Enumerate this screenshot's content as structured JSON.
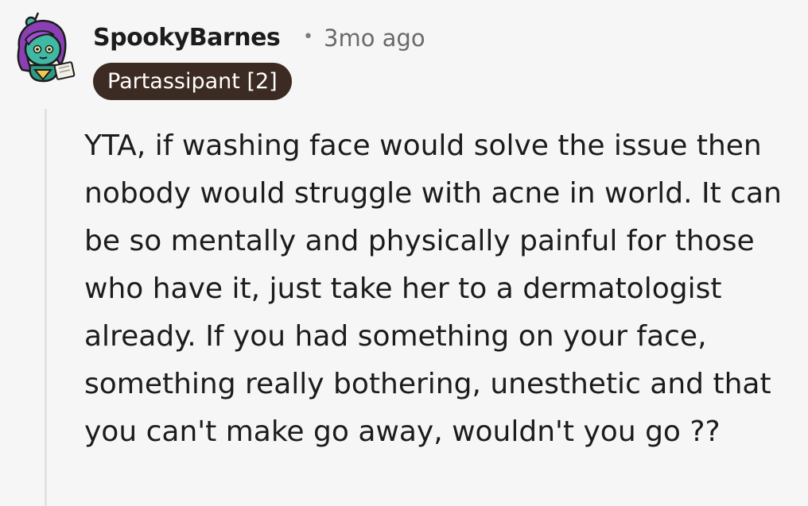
{
  "comment": {
    "author": "SpookyBarnes",
    "separator": "•",
    "timestamp": "3mo ago",
    "flair": "Partassipant [2]",
    "body": "YTA, if washing face would solve the issue then nobody would struggle with acne in world. It can be so mentally and physically painful for those who have it, just take her to a dermatologist already. If you had something on your face, something really bothering, unesthetic and that you can't make go away, wouldn't you go ??"
  },
  "colors": {
    "background": "#f6f6f6",
    "flair_bg": "#3c2b22",
    "flair_text": "#ffffff",
    "username": "#1c1c1c",
    "meta": "#6a6a6a",
    "thread_line": "#e2e2e2",
    "avatar_hair": "#8a3fb5",
    "avatar_skin": "#3fb9a3"
  },
  "icons": {
    "avatar": "snoo-avatar-icon"
  }
}
